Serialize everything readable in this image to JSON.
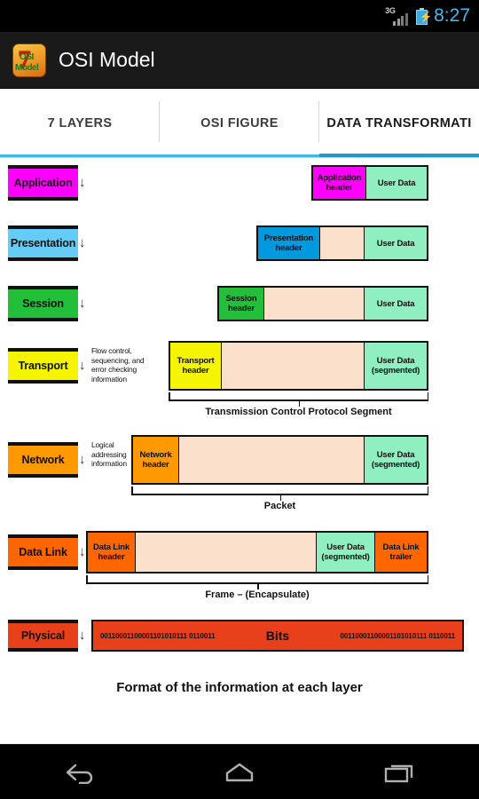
{
  "status_bar": {
    "network_type": "3G",
    "signal_icon": "signal-bars-icon",
    "battery_icon": "battery-charging-icon",
    "clock": "8:27"
  },
  "action_bar": {
    "app_icon": "osi-model-app-icon",
    "icon_seven": "7",
    "icon_text_top": "OSI",
    "icon_text_bottom": "Model",
    "title": "OSI Model"
  },
  "tabs": [
    {
      "label": "7 LAYERS",
      "active": false
    },
    {
      "label": "OSI FIGURE",
      "active": false
    },
    {
      "label": "DATA TRANSFORMATI",
      "active": true
    }
  ],
  "accent_color": "#33b5e5",
  "diagram": {
    "caption": "Format of the information at each layer",
    "arrow_glyph": "↓",
    "rows": [
      {
        "layer": "Application",
        "layer_color": "#FF00FF",
        "note": "",
        "cells": [
          {
            "label": "Application header",
            "color": "#FF00FF"
          },
          {
            "label": "User Data",
            "color": "#8FEFC0"
          }
        ],
        "brace_label": ""
      },
      {
        "layer": "Presentation",
        "layer_color": "#66CCF5",
        "note": "",
        "cells": [
          {
            "label": "Presentation header",
            "color": "#0099DD"
          },
          {
            "label": "",
            "color": "#FBE0CC"
          },
          {
            "label": "User Data",
            "color": "#8FEFC0"
          }
        ],
        "brace_label": ""
      },
      {
        "layer": "Session",
        "layer_color": "#22C03A",
        "note": "",
        "cells": [
          {
            "label": "Session header",
            "color": "#22C03A"
          },
          {
            "label": "",
            "color": "#FBE0CC"
          },
          {
            "label": "User Data",
            "color": "#8FEFC0"
          }
        ],
        "brace_label": ""
      },
      {
        "layer": "Transport",
        "layer_color": "#F5F500",
        "note": "Flow control, sequencing, and error checking information",
        "cells": [
          {
            "label": "Transport header",
            "color": "#F5F500"
          },
          {
            "label": "",
            "color": "#FBE0CC"
          },
          {
            "label": "User Data (segmented)",
            "color": "#8FEFC0"
          }
        ],
        "brace_label": "Transmission Control Protocol Segment"
      },
      {
        "layer": "Network",
        "layer_color": "#FF9900",
        "note": "Logical addressing information",
        "cells": [
          {
            "label": "Network header",
            "color": "#FF9900"
          },
          {
            "label": "",
            "color": "#FBE0CC"
          },
          {
            "label": "User Data (segmented)",
            "color": "#8FEFC0"
          }
        ],
        "brace_label": "Packet"
      },
      {
        "layer": "Data Link",
        "layer_color": "#FF6600",
        "note": "",
        "cells": [
          {
            "label": "Data Link header",
            "color": "#FF6600"
          },
          {
            "label": "",
            "color": "#FBE0CC"
          },
          {
            "label": "User Data (segmented)",
            "color": "#8FEFC0"
          },
          {
            "label": "Data Link trailer",
            "color": "#FF6600"
          }
        ],
        "brace_label": "Frame – (Encapsulate)"
      },
      {
        "layer": "Physical",
        "layer_color": "#E8401A",
        "note": "",
        "cells": [],
        "brace_label": "",
        "bits_left": "00110001100001101010111 0110011",
        "bits_word": "Bits",
        "bits_right": "00110001100001101010111 0110011"
      }
    ]
  },
  "nav_bar": {
    "back": "back-nav-icon",
    "home": "home-nav-icon",
    "recents": "recents-nav-icon"
  }
}
